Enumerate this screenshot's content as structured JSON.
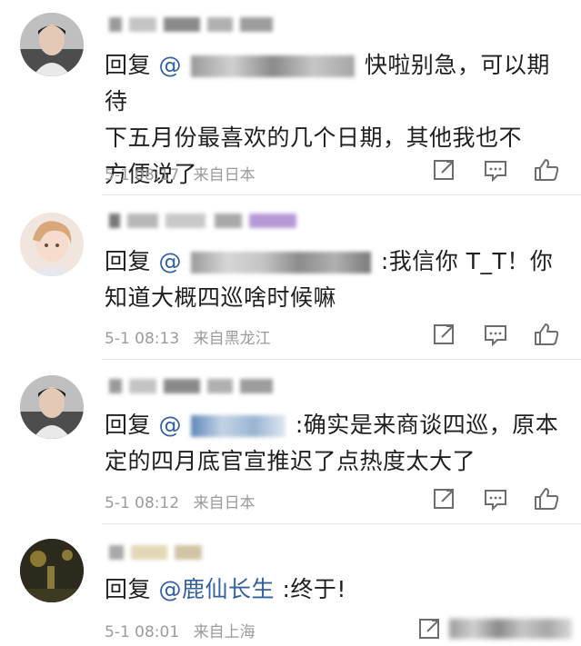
{
  "comments": [
    {
      "reply_prefix": "回复",
      "mention": "@",
      "text_line1": "快啦别急，可以期待",
      "text_line2": "下五月份最喜欢的几个日期，其他我也不",
      "text_line3": "方便说了",
      "time": "5-1 08:17",
      "source": "来自日本"
    },
    {
      "reply_prefix": "回复",
      "mention": "@",
      "text_line1": ":我信你 T_T！你",
      "text_line2": "知道大概四巡啥时候嘛",
      "time": "5-1 08:13",
      "source": "来自黑龙江"
    },
    {
      "reply_prefix": "回复",
      "mention": "@",
      "text_line1": ":确实是来商谈四巡，原本",
      "text_line2": "定的四月底官宣推迟了点热度太大了",
      "time": "5-1 08:12",
      "source": "来自日本"
    },
    {
      "reply_prefix": "回复",
      "mention": "@鹿仙长生",
      "text_line1": ":终于!",
      "time": "5-1 08:01",
      "source": "来自上海"
    }
  ],
  "icons": [
    "share-icon",
    "comment-icon",
    "like-icon"
  ],
  "colors": {
    "mention": "#34619f",
    "meta": "#9b9b9b",
    "divider": "#e6e6e6"
  }
}
